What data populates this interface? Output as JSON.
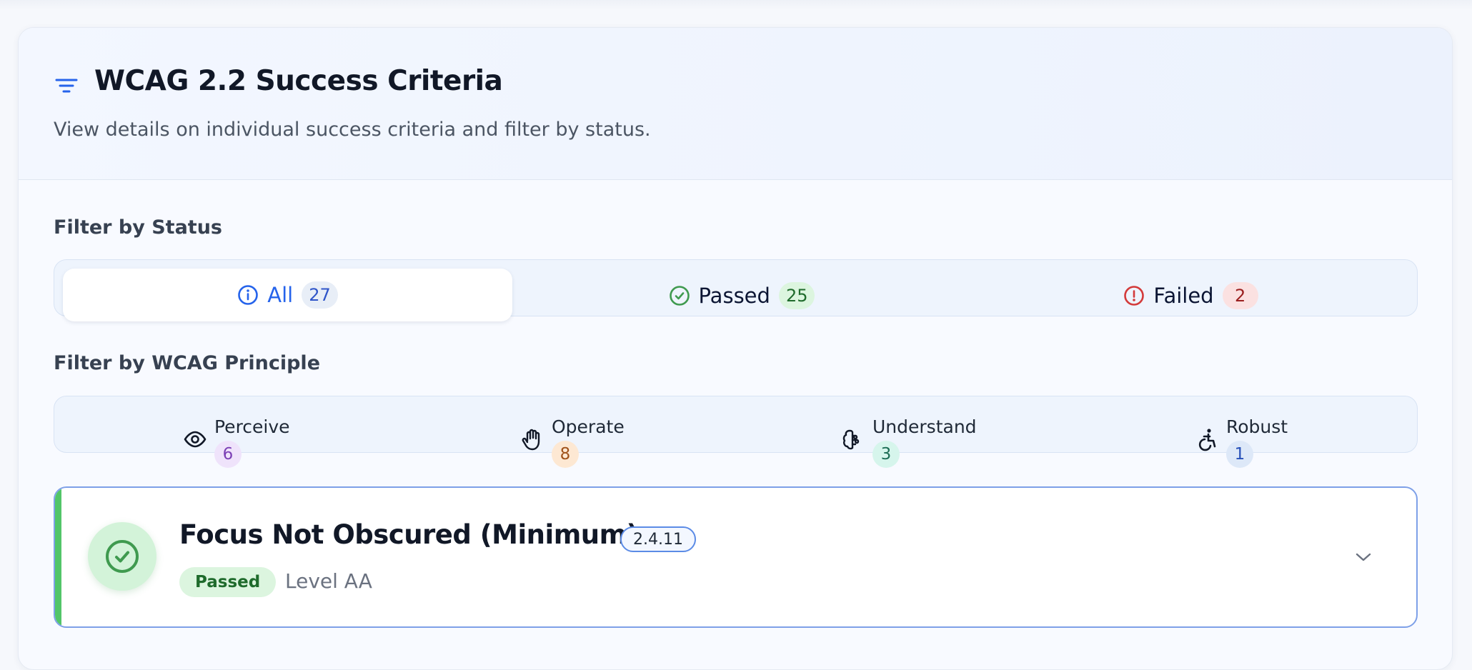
{
  "header": {
    "icon": "filter-icon",
    "title": "WCAG 2.2 Success Criteria",
    "subtitle": "View details on individual success criteria and filter by status."
  },
  "status_filter": {
    "label": "Filter by Status",
    "tabs": [
      {
        "label": "All",
        "count": "27",
        "icon": "info-circle-icon",
        "active": true,
        "color": "#2563eb"
      },
      {
        "label": "Passed",
        "count": "25",
        "icon": "check-circle-icon",
        "active": false,
        "color": "#3f9a4f"
      },
      {
        "label": "Failed",
        "count": "2",
        "icon": "alert-circle-icon",
        "active": false,
        "color": "#d33a3a"
      }
    ]
  },
  "principle_filter": {
    "label": "Filter by WCAG Principle",
    "items": [
      {
        "name": "Perceive",
        "count": "6",
        "icon": "eye-icon",
        "badge_bg": "#efe3fb",
        "badge_fg": "#7b3fb5"
      },
      {
        "name": "Operate",
        "count": "8",
        "icon": "hand-icon",
        "badge_bg": "#fde8d3",
        "badge_fg": "#a0521a"
      },
      {
        "name": "Understand",
        "count": "3",
        "icon": "brain-icon",
        "badge_bg": "#d6f5ec",
        "badge_fg": "#1d6d55"
      },
      {
        "name": "Robust",
        "count": "1",
        "icon": "accessibility-icon",
        "badge_bg": "#dde8f8",
        "badge_fg": "#2750b8"
      }
    ]
  },
  "criterion": {
    "title": "Focus Not Obscured (Minimum)",
    "code": "2.4.11",
    "status": "Passed",
    "level": "Level AA",
    "icon": "check-circle-icon",
    "accent": "#52c568"
  }
}
